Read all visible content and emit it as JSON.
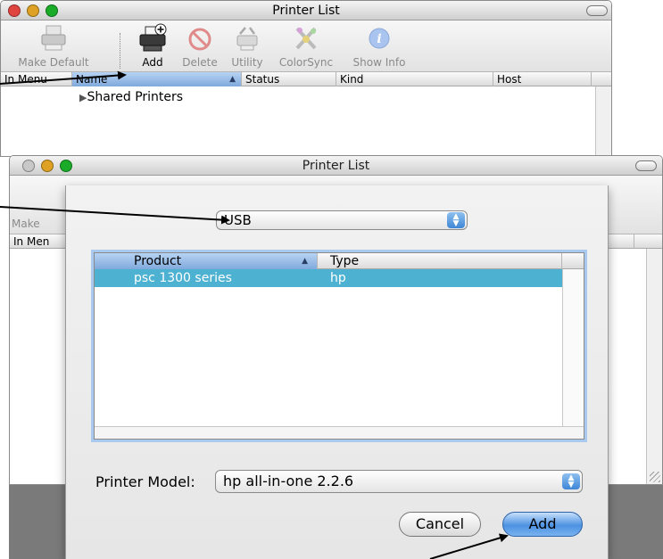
{
  "back_window": {
    "title": "Printer List",
    "toolbar": [
      {
        "label": "Make Default",
        "icon": "make-default-printer-icon",
        "active": false
      },
      {
        "label": "Add",
        "icon": "add-printer-icon",
        "active": true
      },
      {
        "label": "Delete",
        "icon": "delete-icon",
        "active": false
      },
      {
        "label": "Utility",
        "icon": "utility-icon",
        "active": false
      },
      {
        "label": "ColorSync",
        "icon": "colorsync-icon",
        "active": false
      },
      {
        "label": "Show Info",
        "icon": "info-icon",
        "active": false
      }
    ],
    "columns": [
      "In Menu",
      "Name",
      "Status",
      "Kind",
      "Host"
    ],
    "group_row": "Shared Printers"
  },
  "front_window": {
    "title": "Printer List",
    "toolbar_label_partial": "Make",
    "column_partial": "In Men"
  },
  "sheet": {
    "connection_popup": "USB",
    "columns": {
      "product": "Product",
      "type": "Type"
    },
    "rows": [
      {
        "product": "psc 1300 series",
        "type": "hp",
        "selected": true
      }
    ],
    "printer_model_label": "Printer Model:",
    "printer_model_value": "hp all-in-one 2.2.6",
    "cancel_label": "Cancel",
    "add_label": "Add"
  },
  "colors": {
    "traffic_close": "#e0443e",
    "traffic_minimize": "#dea123",
    "traffic_zoom": "#1aab29",
    "selection": "#4db1d2",
    "default_button": "#4c92e2"
  }
}
